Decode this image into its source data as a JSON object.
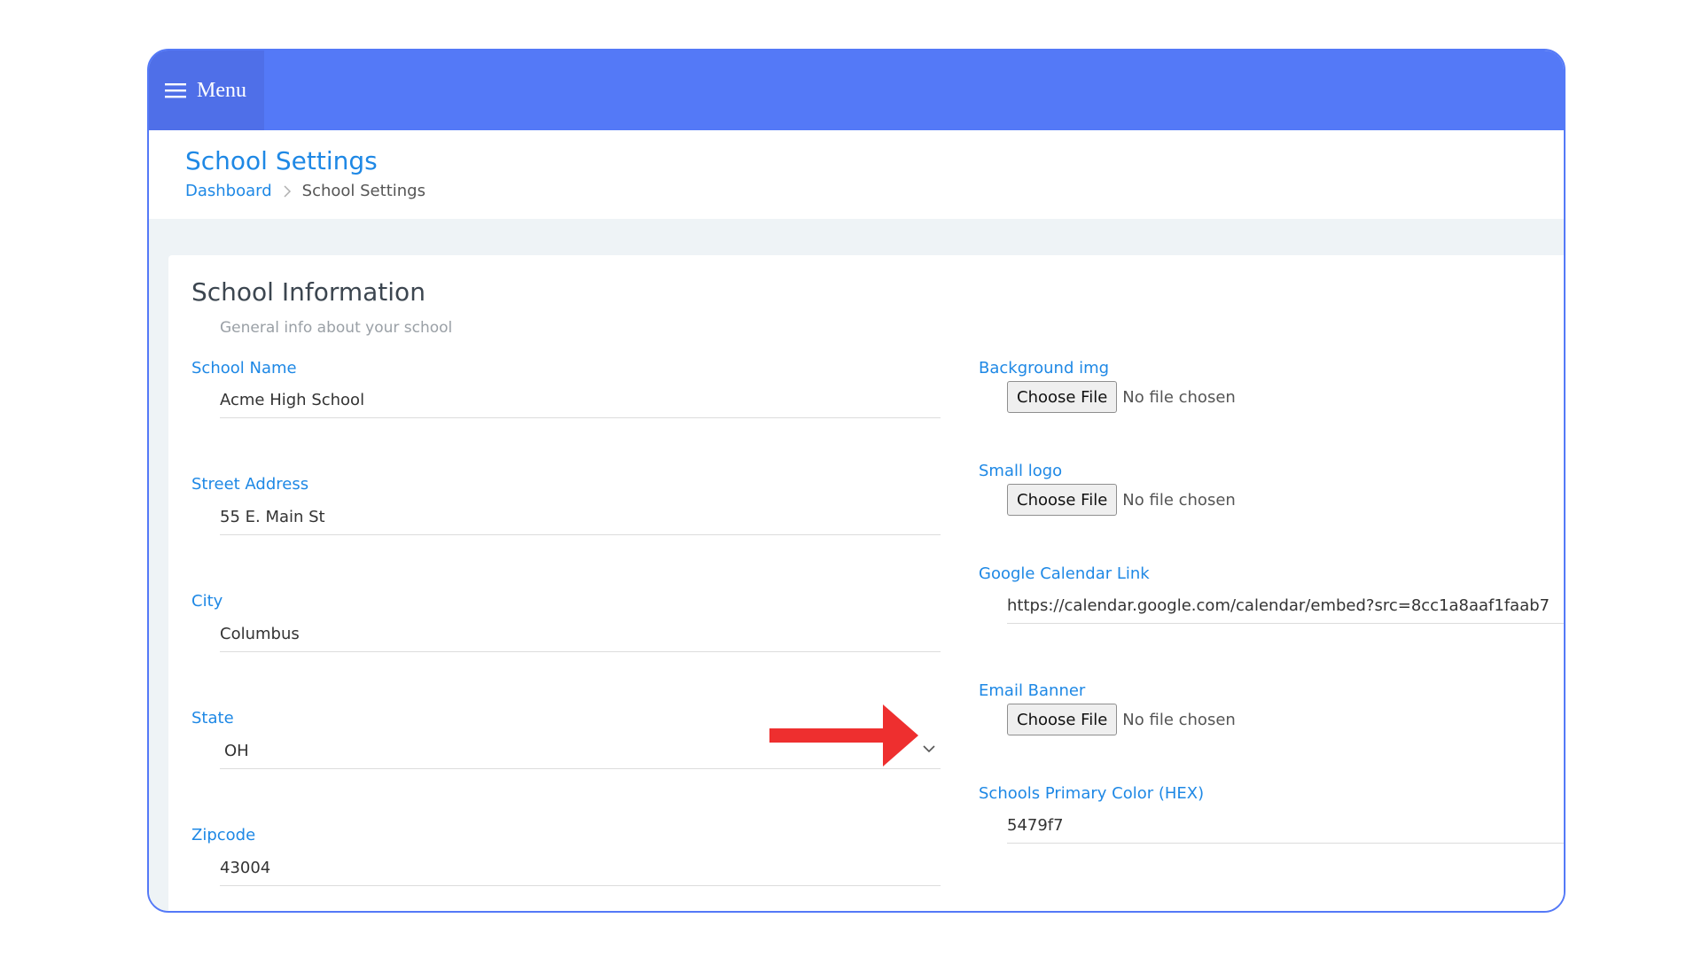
{
  "topbar": {
    "menu_label": "Menu",
    "menu_icon": "hamburger-icon",
    "color": "#5479f7"
  },
  "header": {
    "title": "School Settings",
    "breadcrumb": {
      "link": "Dashboard",
      "current": "School Settings",
      "separator_icon": "chevron-right-icon"
    }
  },
  "card": {
    "title": "School Information",
    "subtitle": "General info about your school"
  },
  "left_fields": {
    "school_name": {
      "label": "School Name",
      "value": "Acme High School"
    },
    "street_address": {
      "label": "Street Address",
      "value": "55 E. Main St"
    },
    "city": {
      "label": "City",
      "value": "Columbus"
    },
    "state": {
      "label": "State",
      "value": "OH"
    },
    "zipcode": {
      "label": "Zipcode",
      "value": "43004"
    }
  },
  "right_fields": {
    "background_img": {
      "label": "Background img",
      "button": "Choose File",
      "status": "No file chosen"
    },
    "small_logo": {
      "label": "Small logo",
      "button": "Choose File",
      "status": "No file chosen"
    },
    "google_calendar": {
      "label": "Google Calendar Link",
      "value": "https://calendar.google.com/calendar/embed?src=8cc1a8aaf1faab7"
    },
    "email_banner": {
      "label": "Email Banner",
      "button": "Choose File",
      "status": "No file chosen"
    },
    "primary_color": {
      "label": "Schools Primary Color (HEX)",
      "value": "5479f7"
    }
  },
  "annotation": {
    "arrow_color": "#ee2f2f",
    "arrow_icon": "right-arrow-annotation"
  },
  "colors": {
    "accent": "#1e88e5",
    "brand": "#5479f7",
    "content_bg": "#eef3f6"
  }
}
